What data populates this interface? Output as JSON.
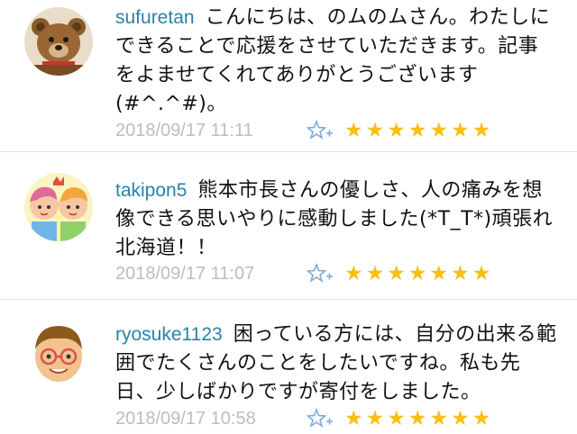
{
  "comments": [
    {
      "username": "sufuretan",
      "text": "こんにちは、のムのムさん。わたしにできることで応援をさせていただきます。記事をよませてくれてありがとうございます(#^.^#)。",
      "timestamp": "2018/09/17 11:11",
      "stars": 7,
      "avatar_icon": "teddy-bear-avatar"
    },
    {
      "username": "takipon5",
      "text": "熊本市長さんの優しさ、人の痛みを想像できる思いやりに感動しました(*T_T*)頑張れ北海道！！",
      "timestamp": "2018/09/17 11:07",
      "stars": 7,
      "avatar_icon": "cartoon-kids-avatar"
    },
    {
      "username": "ryosuke1123",
      "text": "困っている方には、自分の出来る範囲でたくさんのことをしたいですね。私も先日、少しばかりですが寄付をしました。",
      "timestamp": "2018/09/17 10:58",
      "stars": 7,
      "avatar_icon": "boy-with-glasses-avatar"
    }
  ],
  "colors": {
    "username": "#2a82a8",
    "star": "#f7bf17",
    "add_star": "#7ba7d4",
    "timestamp": "#bdbdbd",
    "divider": "#e6e6e6"
  },
  "icons": {
    "add_star": "add-star-icon",
    "star": "star-icon"
  }
}
